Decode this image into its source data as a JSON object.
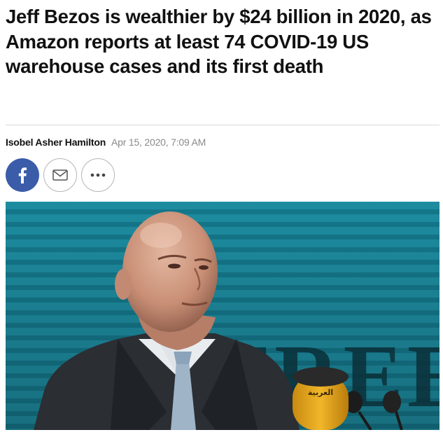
{
  "article": {
    "headline": "Jeff Bezos is wealthier by $24 billion in 2020, as Amazon reports at least 74 COVID-19 US warehouse cases and its first death",
    "author": "Isobel Asher Hamilton",
    "timestamp": "Apr 15, 2020, 7:09 AM"
  },
  "share": {
    "buttons": [
      {
        "name": "facebook",
        "icon": "facebook-icon",
        "color": "#3b5ca8"
      },
      {
        "name": "email",
        "icon": "mail-icon"
      },
      {
        "name": "more",
        "icon": "more-icon"
      }
    ]
  },
  "photo": {
    "backdrop_text": "FREE",
    "mic_text": "العربية"
  },
  "colors": {
    "headline": "#111111",
    "date": "#8a8a8a",
    "facebook": "#3b5ca8",
    "photo_backdrop": "#1e8fa3"
  }
}
